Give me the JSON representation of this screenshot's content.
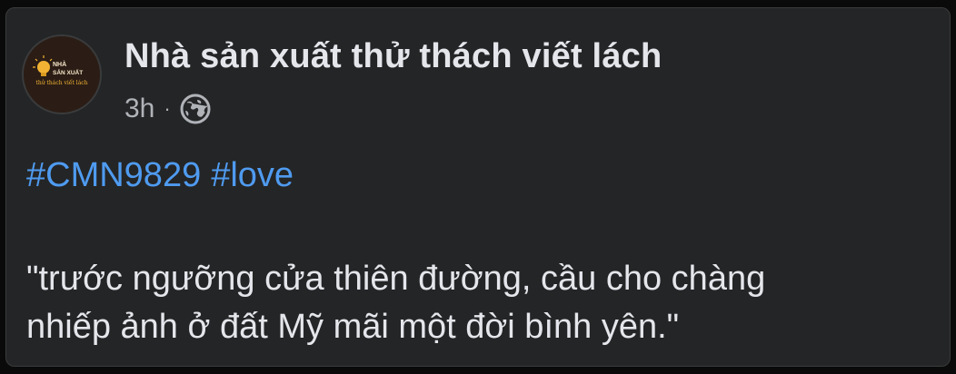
{
  "post": {
    "author": "Nhà sản xuất thử thách viết lách",
    "avatar_logo_text": [
      "NHÀ",
      "SẢN XUẤT",
      "thử thách viết lách"
    ],
    "timestamp": "3h",
    "separator": "·",
    "privacy_icon": "globe-icon",
    "hashtags": [
      "#CMN9829",
      "#love"
    ],
    "body_lines": [
      "\"trước ngưỡng cửa thiên đường, cầu cho chàng",
      "nhiếp ảnh ở đất Mỹ mãi một đời bình yên.\""
    ]
  },
  "colors": {
    "background": "#242526",
    "text_primary": "#e4e6eb",
    "text_secondary": "#b0b3b8",
    "hashtag": "#4f9bf0",
    "avatar_bg": "#2b1d15",
    "avatar_accent": "#f2b233"
  }
}
